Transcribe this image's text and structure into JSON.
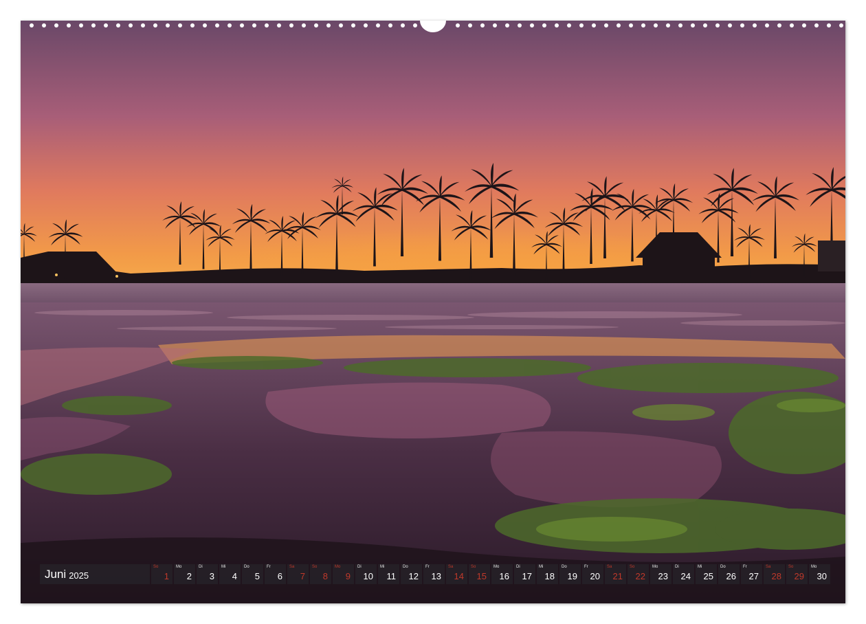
{
  "calendar": {
    "month": "Juni",
    "year": "2025",
    "days": [
      {
        "wd": "So",
        "num": "1",
        "holiday": true
      },
      {
        "wd": "Mo",
        "num": "2",
        "holiday": false
      },
      {
        "wd": "Di",
        "num": "3",
        "holiday": false
      },
      {
        "wd": "Mi",
        "num": "4",
        "holiday": false
      },
      {
        "wd": "Do",
        "num": "5",
        "holiday": false
      },
      {
        "wd": "Fr",
        "num": "6",
        "holiday": false
      },
      {
        "wd": "Sa",
        "num": "7",
        "holiday": true
      },
      {
        "wd": "So",
        "num": "8",
        "holiday": true
      },
      {
        "wd": "Mo",
        "num": "9",
        "holiday": true
      },
      {
        "wd": "Di",
        "num": "10",
        "holiday": false
      },
      {
        "wd": "Mi",
        "num": "11",
        "holiday": false
      },
      {
        "wd": "Do",
        "num": "12",
        "holiday": false
      },
      {
        "wd": "Fr",
        "num": "13",
        "holiday": false
      },
      {
        "wd": "Sa",
        "num": "14",
        "holiday": true
      },
      {
        "wd": "So",
        "num": "15",
        "holiday": true
      },
      {
        "wd": "Mo",
        "num": "16",
        "holiday": false
      },
      {
        "wd": "Di",
        "num": "17",
        "holiday": false
      },
      {
        "wd": "Mi",
        "num": "18",
        "holiday": false
      },
      {
        "wd": "Do",
        "num": "19",
        "holiday": false
      },
      {
        "wd": "Fr",
        "num": "20",
        "holiday": false
      },
      {
        "wd": "Sa",
        "num": "21",
        "holiday": true
      },
      {
        "wd": "So",
        "num": "22",
        "holiday": true
      },
      {
        "wd": "Mo",
        "num": "23",
        "holiday": false
      },
      {
        "wd": "Di",
        "num": "24",
        "holiday": false
      },
      {
        "wd": "Mi",
        "num": "25",
        "holiday": false
      },
      {
        "wd": "Do",
        "num": "26",
        "holiday": false
      },
      {
        "wd": "Fr",
        "num": "27",
        "holiday": false
      },
      {
        "wd": "Sa",
        "num": "28",
        "holiday": true
      },
      {
        "wd": "So",
        "num": "29",
        "holiday": true
      },
      {
        "wd": "Mo",
        "num": "30",
        "holiday": false
      }
    ]
  },
  "colors": {
    "holiday_red": "#c0392b",
    "cell_bg": "#262228",
    "sky_top": "#6e4a6a",
    "sky_horizon": "#f6a23c"
  }
}
